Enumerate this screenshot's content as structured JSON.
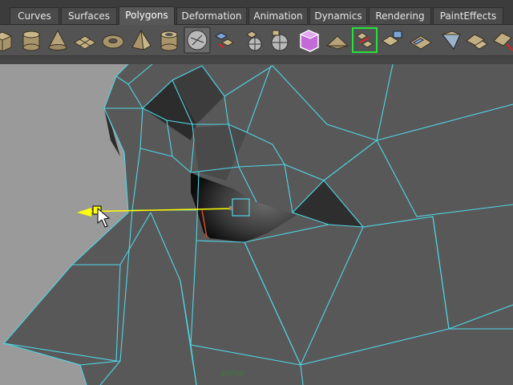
{
  "shelf": {
    "tabs": [
      {
        "label": "Curves"
      },
      {
        "label": "Surfaces"
      },
      {
        "label": "Polygons"
      },
      {
        "label": "Deformation"
      },
      {
        "label": "Animation"
      },
      {
        "label": "Dynamics"
      },
      {
        "label": "Rendering"
      },
      {
        "label": "PaintEffects"
      }
    ],
    "active_tab": "Polygons",
    "icons": [
      "poly-cube-icon",
      "poly-cylinder-icon",
      "poly-cone-icon",
      "poly-plane-icon",
      "poly-torus-icon",
      "poly-pyramid-icon",
      "poly-pipe-icon",
      "soccer-ball-icon",
      "combine-icon",
      "separate-icon",
      "sphere-mesh-icon",
      "extract-icon",
      "smooth-proxy-icon",
      "bridge-icon",
      "split-polygon-icon",
      "extrude-face-icon",
      "merge-vertex-icon",
      "bevel-icon",
      "append-polygon-icon",
      "wedge-face-icon",
      "cut-faces-icon"
    ]
  },
  "viewport": {
    "camera_label": "persp",
    "wire_color": "#4fd6e6",
    "mesh_color": "#585858",
    "background_color": "#9a9a9a",
    "manipulator_color": "#ffff00"
  }
}
